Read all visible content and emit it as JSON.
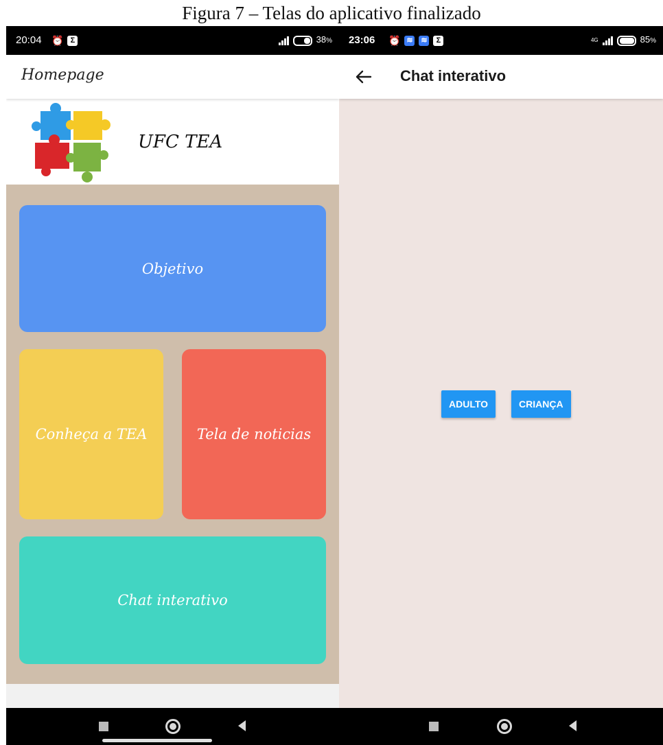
{
  "caption": "Figura 7 – Telas do aplicativo finalizado",
  "left_screen": {
    "status": {
      "time": "20:04",
      "battery": "38",
      "battery_unit": "%"
    },
    "appbar_title": "Homepage",
    "brand": "UFC TEA",
    "tiles": {
      "objetivo": "Objetivo",
      "conheca": "Conheça a TEA",
      "noticias": "Tela de noticias",
      "chat": "Chat interativo"
    },
    "colors": {
      "objetivo": "#5794f2",
      "conheca": "#f4ce54",
      "noticias": "#f26756",
      "chat": "#42d5c2",
      "grid_bg": "#cfbeab"
    }
  },
  "right_screen": {
    "status": {
      "time": "23:06",
      "network": "4G",
      "battery": "85",
      "battery_unit": "%"
    },
    "appbar_title": "Chat interativo",
    "buttons": {
      "adult": "ADULTO",
      "child": "CRIANÇA"
    },
    "colors": {
      "background": "#efe4e1",
      "button": "#2196f3"
    }
  }
}
